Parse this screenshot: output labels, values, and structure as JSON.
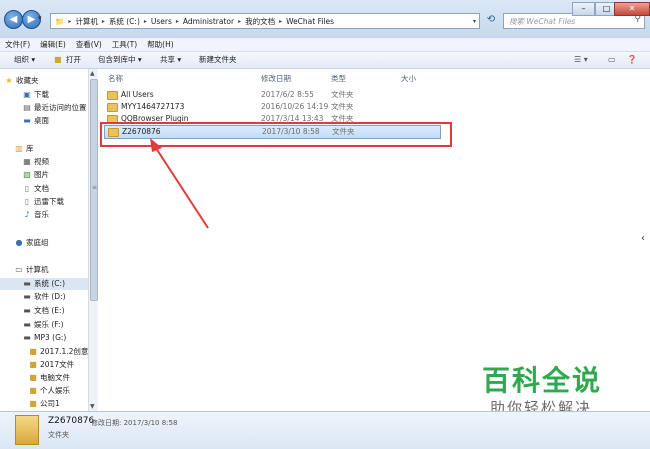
{
  "address": {
    "segments": [
      "计算机",
      "系统 (C:)",
      "Users",
      "Administrator",
      "我的文档",
      "WeChat Files"
    ]
  },
  "search": {
    "placeholder": "搜索 WeChat Files"
  },
  "menu": [
    "文件(F)",
    "编辑(E)",
    "查看(V)",
    "工具(T)",
    "帮助(H)"
  ],
  "toolbar": {
    "organize": "组织 ▾",
    "open": "打开",
    "include": "包含到库中 ▾",
    "share": "共享 ▾",
    "new_folder": "新建文件夹"
  },
  "sidebar": {
    "favorites": "收藏夹",
    "downloads": "下载",
    "recent": "最近访问的位置",
    "desktop": "桌面",
    "libraries": "库",
    "videos": "视频",
    "pictures": "图片",
    "documents": "文档",
    "thunder": "迅雷下载",
    "music": "音乐",
    "homegroup": "家庭组",
    "computer": "计算机",
    "drive_c": "系统 (C:)",
    "drive_d": "软件 (D:)",
    "drive_e": "文档 (E:)",
    "drive_f": "娱乐 (F:)",
    "drive_g": "MP3 (G:)",
    "g1": "2017.1.2创意图",
    "g2": "2017文件",
    "g3": "电脑文件",
    "g4": "个人娱乐",
    "g5": "公司1"
  },
  "columns": {
    "name": "名称",
    "date": "修改日期",
    "type": "类型",
    "size": "大小"
  },
  "files": [
    {
      "name": "All Users",
      "date": "2017/6/2 8:55",
      "type": "文件夹"
    },
    {
      "name": "MYY1464727173",
      "date": "2016/10/26 14:19",
      "type": "文件夹"
    },
    {
      "name": "QQBrowser Plugin",
      "date": "2017/3/14 13:43",
      "type": "文件夹"
    },
    {
      "name": "Z2670876",
      "date": "2017/3/10 8:58",
      "type": "文件夹"
    }
  ],
  "details": {
    "name": "Z2670876",
    "modified": "修改日期: 2017/3/10 8:58",
    "type": "文件夹"
  },
  "watermark": {
    "title": "百科全说",
    "subtitle": "助你轻松解决"
  }
}
